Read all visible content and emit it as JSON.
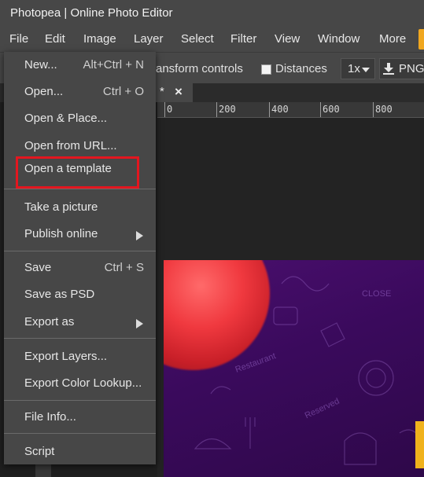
{
  "app": {
    "title": "Photopea | Online Photo Editor"
  },
  "menubar": {
    "items": [
      "File",
      "Edit",
      "Image",
      "Layer",
      "Select",
      "Filter",
      "View",
      "Window",
      "More"
    ]
  },
  "options": {
    "transform_label": "ansform controls",
    "distances_label": "Distances",
    "zoom": "1x",
    "export_label": "PNG"
  },
  "tab": {
    "marker": "*",
    "close": "×"
  },
  "ruler": {
    "labels": [
      "0",
      "200",
      "400",
      "600",
      "800"
    ]
  },
  "file_menu": {
    "items": [
      {
        "label": "New...",
        "shortcut": "Alt+Ctrl + N"
      },
      {
        "label": "Open...",
        "shortcut": "Ctrl + O"
      },
      {
        "label": "Open & Place..."
      },
      {
        "label": "Open from URL..."
      },
      {
        "label": "Open a template"
      },
      {
        "label": "Take a picture"
      },
      {
        "label": "Publish online"
      },
      {
        "label": "Save",
        "shortcut": "Ctrl + S"
      },
      {
        "label": "Save as PSD"
      },
      {
        "label": "Export as"
      },
      {
        "label": "Export Layers..."
      },
      {
        "label": "Export Color Lookup..."
      },
      {
        "label": "File Info..."
      },
      {
        "label": "Script"
      }
    ]
  },
  "canvas": {
    "doodle_1": "Restaurant",
    "doodle_2": "Reserved",
    "doodle_3": "CLOSE"
  },
  "colors": {
    "accent": "#f0a71f",
    "highlight_box": "#e3161f",
    "panel": "#474747"
  }
}
